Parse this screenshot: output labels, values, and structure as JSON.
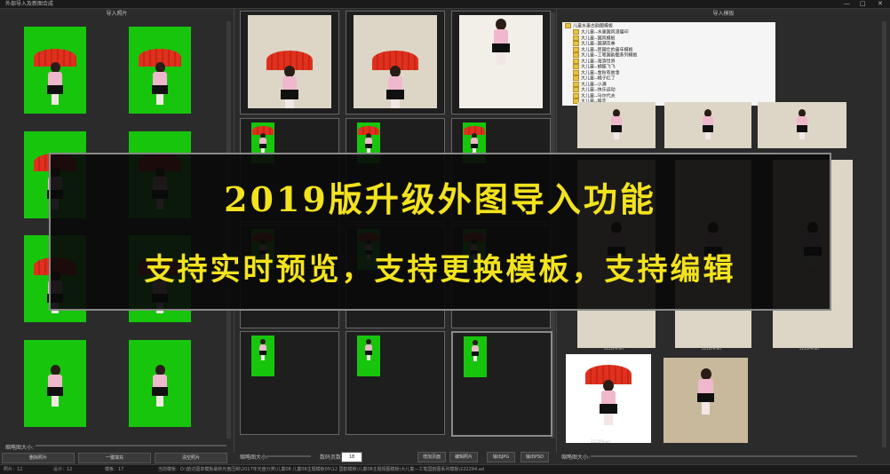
{
  "window": {
    "title": "外部导入及新图合成",
    "controls": {
      "minimize": "—",
      "maximize": "□",
      "close": "✕"
    }
  },
  "left_panel": {
    "header": "导入照片",
    "thumb_size_label": "缩略图大小:",
    "buttons": {
      "delete": "删除照片",
      "fill": "一键填充",
      "clear": "清空照片"
    }
  },
  "middle_panel": {
    "thumb_size_label": "缩略图大小:",
    "page_label": "数码页数:",
    "page_value": "18",
    "buttons": {
      "add_page": "增加页面",
      "edit_photo": "编辑照片",
      "export_jpg": "输出JPG",
      "export_psd": "输出PSD"
    }
  },
  "right_panel": {
    "header": "导入模板",
    "thumb_size_label": "缩略图大小:",
    "tree": {
      "root": "儿童水墨古韵图模板",
      "items": [
        "大儿童--水墨国风漫展印",
        "大儿童--国风模板",
        "大儿童--国潮花卷",
        "大儿童--民国仕的童年模板",
        "大儿童--工笔国韵图系列模板",
        "大儿童--海滨世界",
        "大儿童--蝴蝶飞飞",
        "大儿童--金秋有故事",
        "大儿童--橘子红了",
        "大儿童--小满",
        "大儿童--快乐运动",
        "大儿童--马尔代夫",
        "大儿童--蝶恋"
      ]
    },
    "captions": [
      "2222PH.ad",
      "2222PH.ad",
      "2222PH.ad",
      "2222PH.ad"
    ]
  },
  "statusbar": {
    "photos": "照片：12",
    "designs": "设计：12",
    "templates": "模板：17",
    "path": "当前模板：D:\\韵达图单模板最新光盘压制\\2017年光盘分类\\儿童08 儿童08主题模板05\\12 国韵模板\\儿童08主题视图模板\\大儿童—工笔国韵图系列模板\\222294.ad"
  },
  "banner": {
    "line1": "2019版升级外图导入功能",
    "line2": "支持实时预览，支持更换模板，支持编辑"
  },
  "colors": {
    "accent": "#f3e31d",
    "green_screen": "#17c60c"
  }
}
